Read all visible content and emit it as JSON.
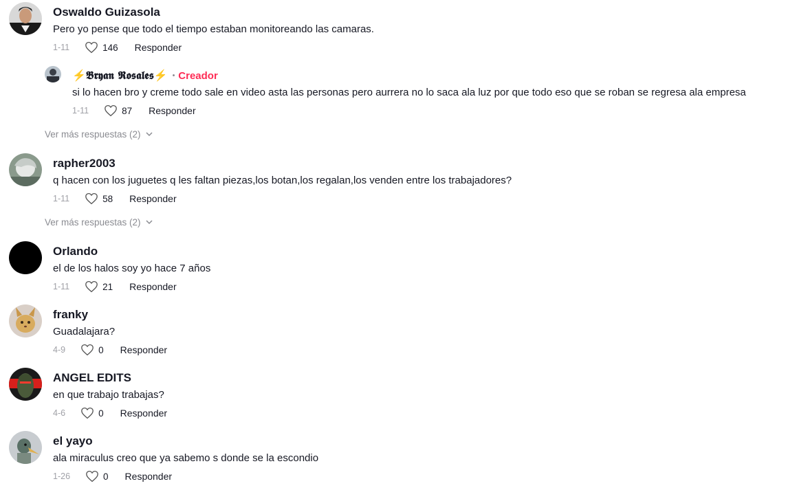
{
  "comments": [
    {
      "user": "Oswaldo Guizasola",
      "text": "Pero yo pense que todo el tiempo estaban monitoreando las camaras.",
      "date": "1-11",
      "likes": "146",
      "reply": "Responder"
    },
    {
      "user": "⚡𝕭𝖗𝖞𝖆𝖓 𝕽𝖔𝖘𝖆𝖑𝖊𝖘⚡",
      "creator": "Creador",
      "text": "si lo hacen bro y creme todo sale en video asta las personas pero aurrera no lo saca ala luz por que todo eso que se roban se regresa ala empresa",
      "date": "1-11",
      "likes": "87",
      "reply": "Responder"
    },
    {
      "user": "rapher2003",
      "text": "q hacen con los juguetes q les faltan piezas,los botan,los regalan,los venden entre los trabajadores?",
      "date": "1-11",
      "likes": "58",
      "reply": "Responder"
    },
    {
      "user": "Orlando",
      "text": "el de los halos soy yo hace 7 años",
      "date": "1-11",
      "likes": "21",
      "reply": "Responder"
    },
    {
      "user": "franky",
      "text": "Guadalajara?",
      "date": "4-9",
      "likes": "0",
      "reply": "Responder"
    },
    {
      "user": "ANGEL EDITS",
      "text": "en que trabajo trabajas?",
      "date": "4-6",
      "likes": "0",
      "reply": "Responder"
    },
    {
      "user": "el yayo",
      "text": "ala miraculus creo que ya sabemo s donde se la escondio",
      "date": "1-26",
      "likes": "0",
      "reply": "Responder"
    }
  ],
  "more_replies": [
    "Ver más respuestas (2)",
    "Ver más respuestas (2)"
  ],
  "icons": {
    "like": "heart-outline-icon",
    "expand": "chevron-down-icon"
  },
  "colors": {
    "creator": "#fe2c55",
    "muted": "#8a8b91",
    "text": "#161823"
  }
}
